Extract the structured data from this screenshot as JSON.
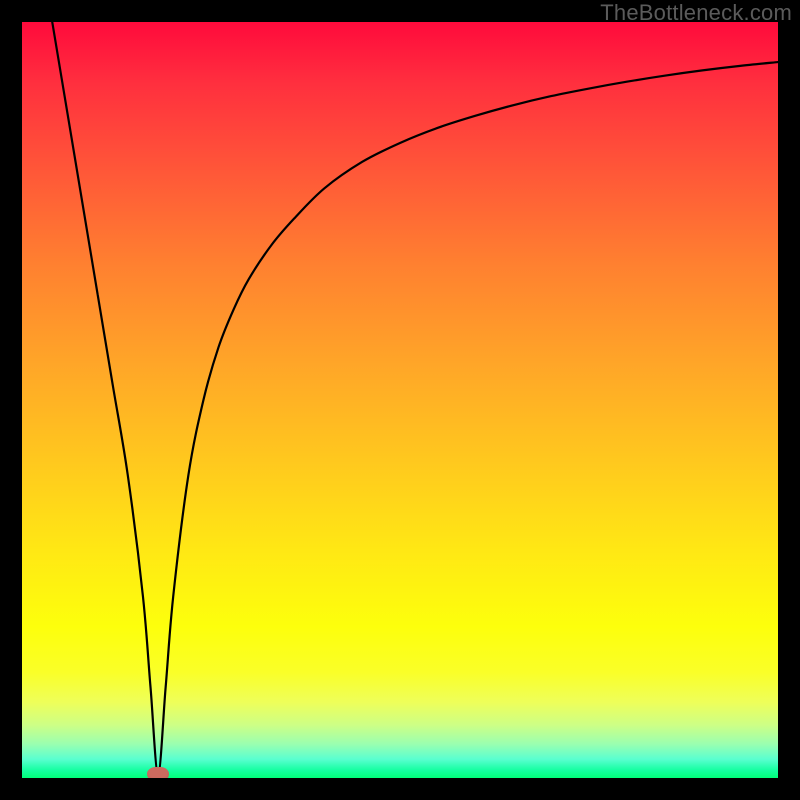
{
  "watermark": "TheBottleneck.com",
  "colors": {
    "frame": "#000000",
    "curve": "#000000",
    "marker": "#cd6a5f",
    "watermark": "#5b5b5b"
  },
  "chart_data": {
    "type": "line",
    "title": "",
    "xlabel": "",
    "ylabel": "",
    "xlim": [
      0,
      100
    ],
    "ylim": [
      0,
      100
    ],
    "grid": false,
    "legend": false,
    "series": [
      {
        "name": "bottleneck-curve",
        "x": [
          4,
          6,
          8,
          10,
          12,
          14,
          16,
          17,
          18,
          19,
          20,
          22,
          24,
          26,
          28,
          30,
          33,
          36,
          40,
          45,
          50,
          55,
          60,
          65,
          70,
          75,
          80,
          85,
          90,
          95,
          100
        ],
        "y": [
          100,
          88,
          76,
          64,
          52,
          40,
          24,
          12,
          0.5,
          12,
          24,
          40,
          50,
          57,
          62,
          66,
          70.5,
          74,
          78,
          81.5,
          84,
          86,
          87.6,
          89,
          90.2,
          91.2,
          92.1,
          92.9,
          93.6,
          94.2,
          94.7
        ]
      }
    ],
    "annotations": [
      {
        "name": "minimum-marker",
        "x": 18,
        "y": 0.5
      }
    ]
  }
}
